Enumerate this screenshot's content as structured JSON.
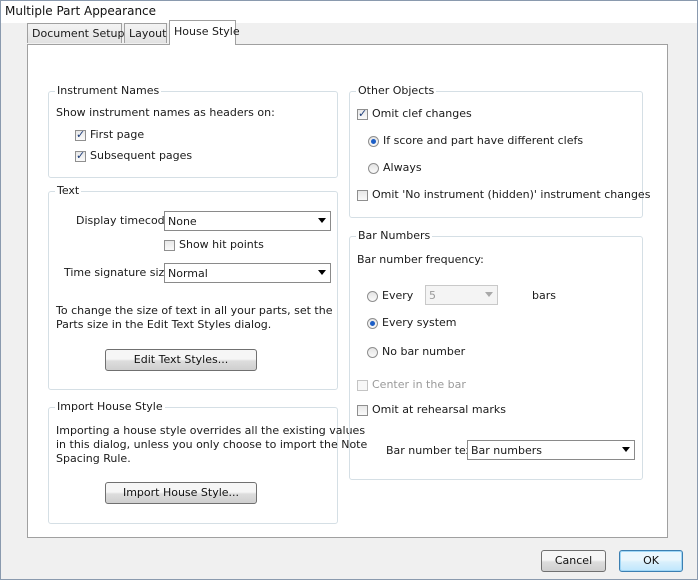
{
  "window": {
    "title": "Multiple Part Appearance"
  },
  "tabs": [
    {
      "label": "Document Setup"
    },
    {
      "label": "Layout"
    },
    {
      "label": "House Style"
    }
  ],
  "instrument_names": {
    "legend": "Instrument Names",
    "prompt": "Show instrument names as headers on:",
    "first_page": {
      "label": "First page",
      "checked": true
    },
    "subsequent_pages": {
      "label": "Subsequent pages",
      "checked": true
    }
  },
  "text_group": {
    "legend": "Text",
    "display_timecode_label": "Display timecode:",
    "display_timecode_value": "None",
    "show_hit_points": {
      "label": "Show hit points",
      "checked": false
    },
    "time_signature_label": "Time signature size:",
    "time_signature_value": "Normal",
    "info_line1": "To change the size of text in all your parts, set the",
    "info_line2": "Parts size in the Edit Text Styles dialog.",
    "edit_text_styles_button": "Edit Text Styles..."
  },
  "import_house_style": {
    "legend": "Import House Style",
    "info_line1": "Importing a house style overrides all the existing values",
    "info_line2": "in this dialog, unless you only choose to import the Note",
    "info_line3": "Spacing Rule.",
    "button": "Import House Style..."
  },
  "other_objects": {
    "legend": "Other Objects",
    "omit_clef_changes": {
      "label": "Omit clef changes",
      "checked": true
    },
    "radio_different_clefs": {
      "label": "If score and part have different clefs",
      "selected": true
    },
    "radio_always": {
      "label": "Always",
      "selected": false
    },
    "omit_no_instrument": {
      "label": "Omit 'No instrument (hidden)' instrument changes",
      "checked": false
    }
  },
  "bar_numbers": {
    "legend": "Bar Numbers",
    "frequency_label": "Bar number frequency:",
    "every_label": "Every",
    "every_value": "5",
    "bars_label": "bars",
    "every_system_label": "Every system",
    "no_bar_number_label": "No bar number",
    "selected_frequency": "Every system",
    "center_in_bar": {
      "label": "Center in the bar",
      "checked": false,
      "enabled": false
    },
    "omit_rehearsal": {
      "label": "Omit at rehearsal marks",
      "checked": false
    },
    "bar_number_text_label": "Bar number text",
    "bar_number_text_value": "Bar numbers"
  },
  "footer": {
    "cancel": "Cancel",
    "ok": "OK"
  }
}
